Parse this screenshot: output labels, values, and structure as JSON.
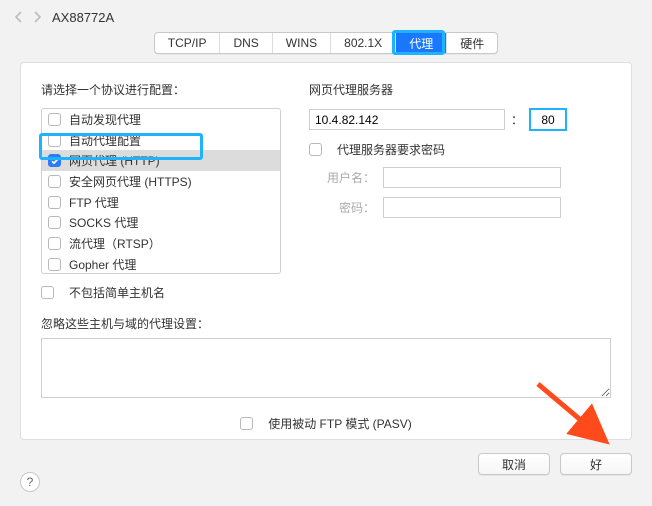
{
  "header": {
    "title": "AX88772A"
  },
  "tabs": {
    "items": [
      {
        "label": "TCP/IP",
        "active": false
      },
      {
        "label": "DNS",
        "active": false
      },
      {
        "label": "WINS",
        "active": false
      },
      {
        "label": "802.1X",
        "active": false
      },
      {
        "label": "代理",
        "active": true
      },
      {
        "label": "硬件",
        "active": false
      }
    ]
  },
  "left": {
    "heading": "请选择一个协议进行配置：",
    "protocols": [
      {
        "label": "自动发现代理",
        "checked": false,
        "selected": false
      },
      {
        "label": "自动代理配置",
        "checked": false,
        "selected": false
      },
      {
        "label": "网页代理 (HTTP)",
        "checked": true,
        "selected": true
      },
      {
        "label": "安全网页代理 (HTTPS)",
        "checked": false,
        "selected": false
      },
      {
        "label": "FTP 代理",
        "checked": false,
        "selected": false
      },
      {
        "label": "SOCKS 代理",
        "checked": false,
        "selected": false
      },
      {
        "label": "流代理（RTSP）",
        "checked": false,
        "selected": false
      },
      {
        "label": "Gopher 代理",
        "checked": false,
        "selected": false
      }
    ],
    "exclude_simple": "不包括简单主机名"
  },
  "right": {
    "heading": "网页代理服务器",
    "ip": "10.4.82.142",
    "colon": "：",
    "port": "80",
    "require_pwd": "代理服务器要求密码",
    "user_label": "用户名：",
    "pass_label": "密码："
  },
  "bypass": {
    "label": "忽略这些主机与域的代理设置：",
    "text": ""
  },
  "pasv": {
    "label": "使用被动 FTP 模式 (PASV)"
  },
  "footer": {
    "help": "?",
    "cancel": "取消",
    "ok": "好"
  },
  "annotation": {
    "arrow_color": "#ff4a1c",
    "highlight_color": "#1fb2ff"
  }
}
